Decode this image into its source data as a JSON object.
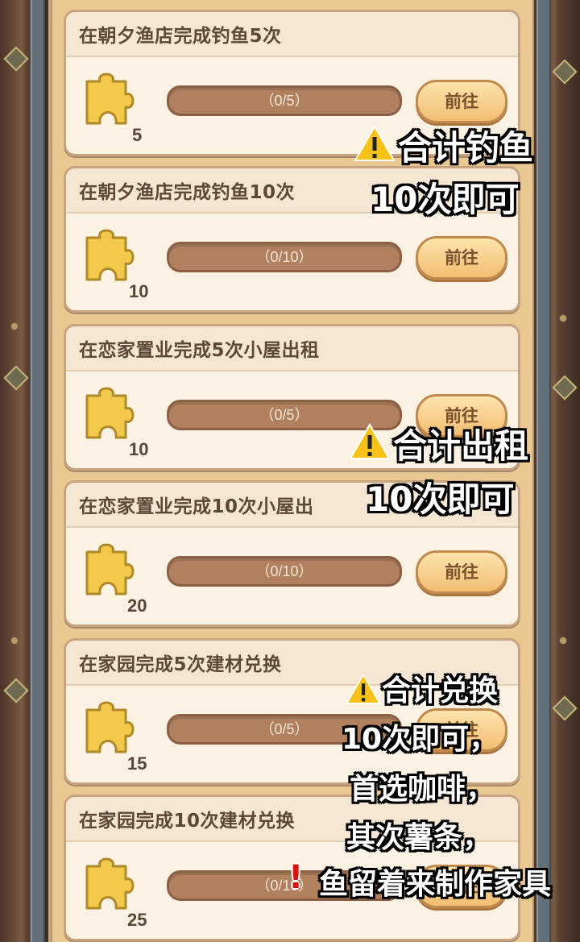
{
  "tasks": [
    {
      "title": "在朝夕渔店完成钓鱼5次",
      "reward": "5",
      "progress_text": "（0/5）",
      "progress": 0,
      "button": "前往"
    },
    {
      "title": "在朝夕渔店完成钓鱼10次",
      "reward": "10",
      "progress_text": "（0/10）",
      "progress": 0,
      "button": "前往"
    },
    {
      "title": "在恋家置业完成5次小屋出租",
      "reward": "10",
      "progress_text": "（0/5）",
      "progress": 0,
      "button": "前往"
    },
    {
      "title": "在恋家置业完成10次小屋出",
      "reward": "20",
      "progress_text": "（0/10）",
      "progress": 0,
      "button": "前往"
    },
    {
      "title": "在家园完成5次建材兑换",
      "reward": "15",
      "progress_text": "（0/5）",
      "progress": 0,
      "button": "前往"
    },
    {
      "title": "在家园完成10次建材兑换",
      "reward": "25",
      "progress_text": "（0/10）",
      "progress": 0,
      "button": "前往"
    }
  ],
  "annotations": {
    "fishing": [
      "合计钓鱼",
      "10次即可"
    ],
    "rent": [
      "合计出租",
      "10次即可"
    ],
    "exchange": [
      "合计兑换",
      "10次即可，",
      "首选咖啡，",
      "其次薯条，",
      "鱼留着来制作家具"
    ],
    "exclamation": "!"
  },
  "colors": {
    "panel": "#e9c892",
    "card": "#fbf2e4",
    "bar": "#b0805f",
    "button": "#f2be72",
    "warning": "#f6c21a",
    "alert": "#e01010"
  }
}
